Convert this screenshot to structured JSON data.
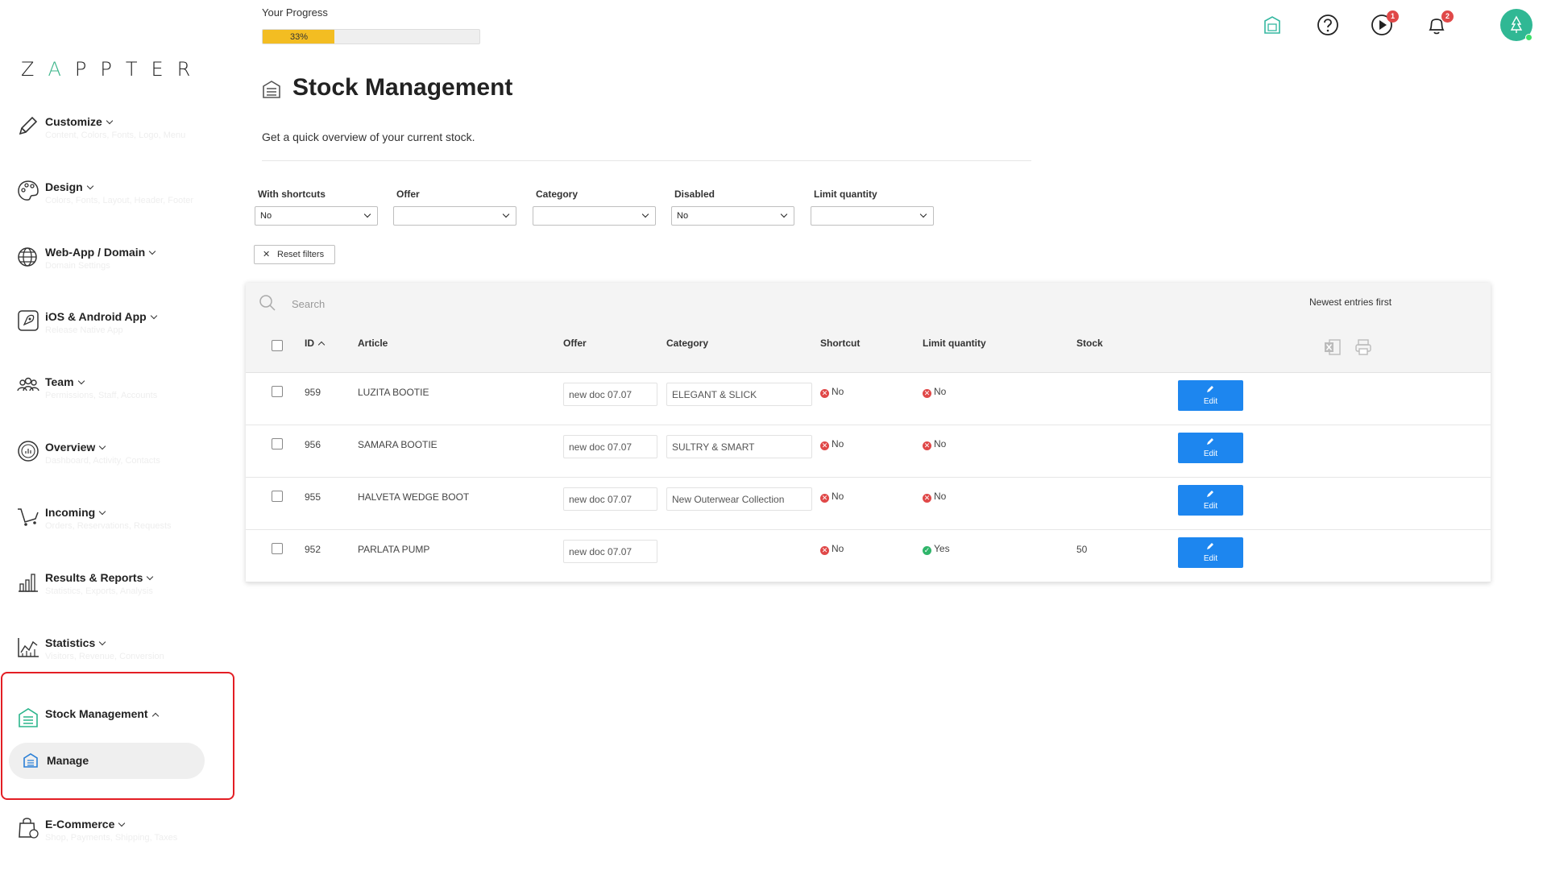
{
  "progress": {
    "label": "Your Progress",
    "value_text": "33%",
    "fraction": 0.33
  },
  "brand": {
    "logo_part1": "Z",
    "logo_accent": "A",
    "logo_part2": "PPTER",
    "accent_color": "#3cb58a"
  },
  "sidebar": {
    "items": [
      {
        "label": "Customize",
        "sub": "Content, Colors, Fonts, Logo, Menu"
      },
      {
        "label": "Design",
        "sub": "Colors, Fonts, Layout, Header, Footer"
      },
      {
        "label": "Web-App / Domain",
        "sub": "Domain Settings"
      },
      {
        "label": "iOS & Android App",
        "sub": "Release Native App"
      },
      {
        "label": "Team",
        "sub": "Permissions, Staff, Accounts"
      },
      {
        "label": "Overview",
        "sub": "Dashboard, Activity, Contacts"
      },
      {
        "label": "Incoming",
        "sub": "Orders, Reservations, Requests"
      },
      {
        "label": "Results & Reports",
        "sub": "Statistics, Exports, Analysis"
      },
      {
        "label": "Statistics",
        "sub": "Visitors, Revenue, Conversion"
      },
      {
        "label": "Stock Management",
        "sub": ""
      },
      {
        "label": "E-Commerce",
        "sub": "Shop, Payments, Shipping, Taxes"
      }
    ],
    "sub_item": {
      "label": "Manage"
    }
  },
  "topbar": {
    "icons": [
      "app-status-icon",
      "help-icon",
      "video-tutorial-icon",
      "notifications-icon"
    ],
    "video_badge": "1",
    "notif_badge": "2"
  },
  "header": {
    "title": "Stock Management",
    "description": "Get a quick overview of your current stock."
  },
  "filters": [
    {
      "label": "With shortcuts",
      "value": "No"
    },
    {
      "label": "Offer",
      "value": ""
    },
    {
      "label": "Category",
      "value": ""
    },
    {
      "label": "Disabled",
      "value": "No"
    },
    {
      "label": "Limit quantity",
      "value": ""
    }
  ],
  "reset": {
    "icon": "✕",
    "label": "Reset filters"
  },
  "table": {
    "search_placeholder": "Search",
    "sort_label": "Newest entries first",
    "columns": {
      "id": "ID",
      "article": "Article",
      "offer": "Offer",
      "category": "Category",
      "shortcut": "Shortcut",
      "limit": "Limit quantity",
      "stock": "Stock"
    },
    "rows": [
      {
        "id": "959",
        "article": "LUZITA BOOTIE",
        "offer": "new doc 07.07",
        "category": "ELEGANT & SLICK",
        "shortcut": "No",
        "limit": "No",
        "stock": "",
        "edit": "Edit"
      },
      {
        "id": "956",
        "article": "SAMARA BOOTIE",
        "offer": "new doc 07.07",
        "category": "SULTRY & SMART",
        "shortcut": "No",
        "limit": "No",
        "stock": "",
        "edit": "Edit"
      },
      {
        "id": "955",
        "article": "HALVETA WEDGE BOOT",
        "offer": "new doc 07.07",
        "category": "New Outerwear Collection",
        "shortcut": "No",
        "limit": "No",
        "stock": "",
        "edit": "Edit"
      },
      {
        "id": "952",
        "article": "PARLATA PUMP",
        "offer": "new doc 07.07",
        "category": "",
        "shortcut": "No",
        "limit": "Yes",
        "stock": "50",
        "edit": "Edit"
      }
    ]
  },
  "colors": {
    "progress": "#f3bd22",
    "edit_button": "#1d86ef",
    "no_status": "#e04848",
    "yes_status": "#2fb56a",
    "highlight": "#e31e24"
  }
}
